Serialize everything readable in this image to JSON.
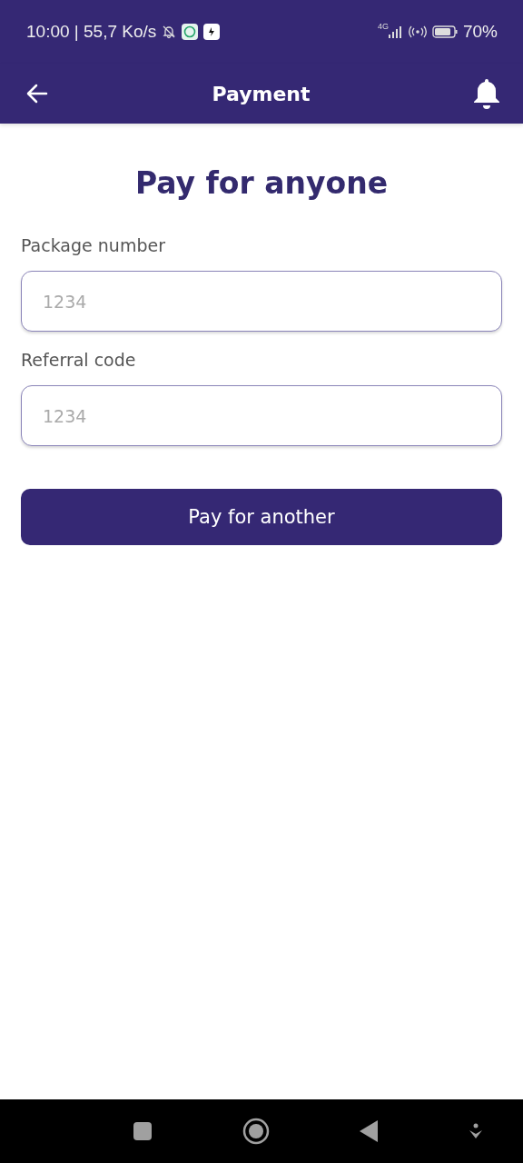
{
  "status_bar": {
    "time_speed": "10:00 | 55,7 Ko/s",
    "network": "4G",
    "battery": "70%"
  },
  "app_bar": {
    "title": "Payment"
  },
  "heading": "Pay for anyone",
  "fields": [
    {
      "label": "Package number",
      "placeholder": "1234"
    },
    {
      "label": "Referral code",
      "placeholder": "1234"
    }
  ],
  "button": "Pay for another"
}
